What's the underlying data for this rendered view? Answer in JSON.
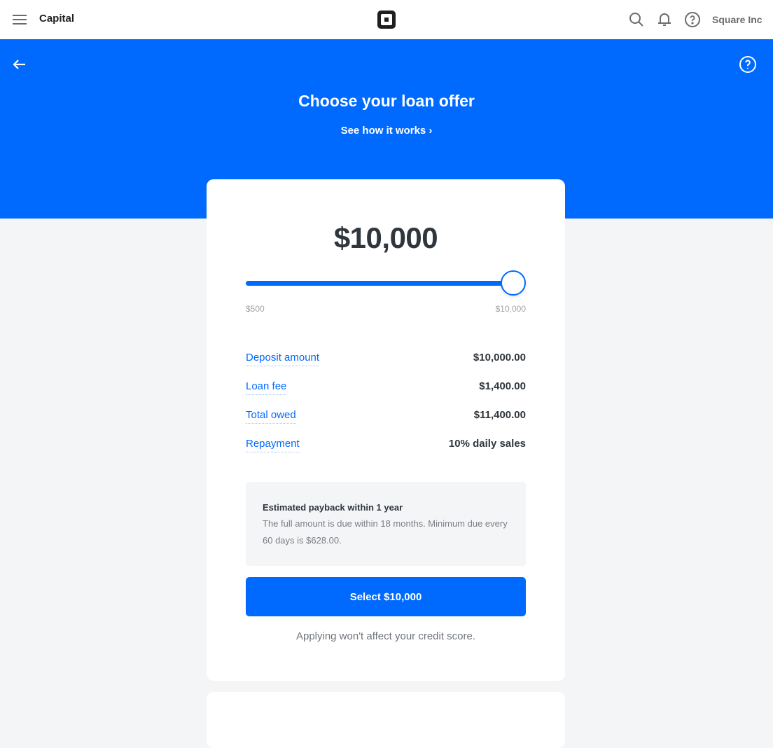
{
  "topbar": {
    "app_title": "Capital",
    "logo": "square-logo-icon",
    "icons": [
      "hamburger-menu-icon",
      "search-icon",
      "bell-icon",
      "help-icon"
    ],
    "account_name": "Square Inc"
  },
  "hero": {
    "title": "Choose your loan offer",
    "link_label": "See how it works ›",
    "back_icon": "arrow-left-icon",
    "help_icon": "help-circle-icon",
    "background_color": "#006aff"
  },
  "offer": {
    "amount": "$10,000",
    "slider": {
      "min_label": "$500",
      "max_label": "$10,000",
      "min_value": 500,
      "max_value": 10000,
      "value": 10000
    },
    "details": [
      {
        "label": "Deposit amount",
        "value": "$10,000.00"
      },
      {
        "label": "Loan fee",
        "value": "$1,400.00"
      },
      {
        "label": "Total owed",
        "value": "$11,400.00"
      },
      {
        "label": "Repayment",
        "value": "10% daily sales"
      }
    ],
    "info": {
      "title": "Estimated payback within 1 year",
      "body": "The full amount is due within 18 months. Minimum due every 60 days is $628.00."
    },
    "select_button_label": "Select $10,000",
    "disclaimer": "Applying won't affect your credit score."
  },
  "colors": {
    "accent": "#006aff",
    "page_background": "#f4f5f7",
    "text_primary": "#2f363d"
  }
}
